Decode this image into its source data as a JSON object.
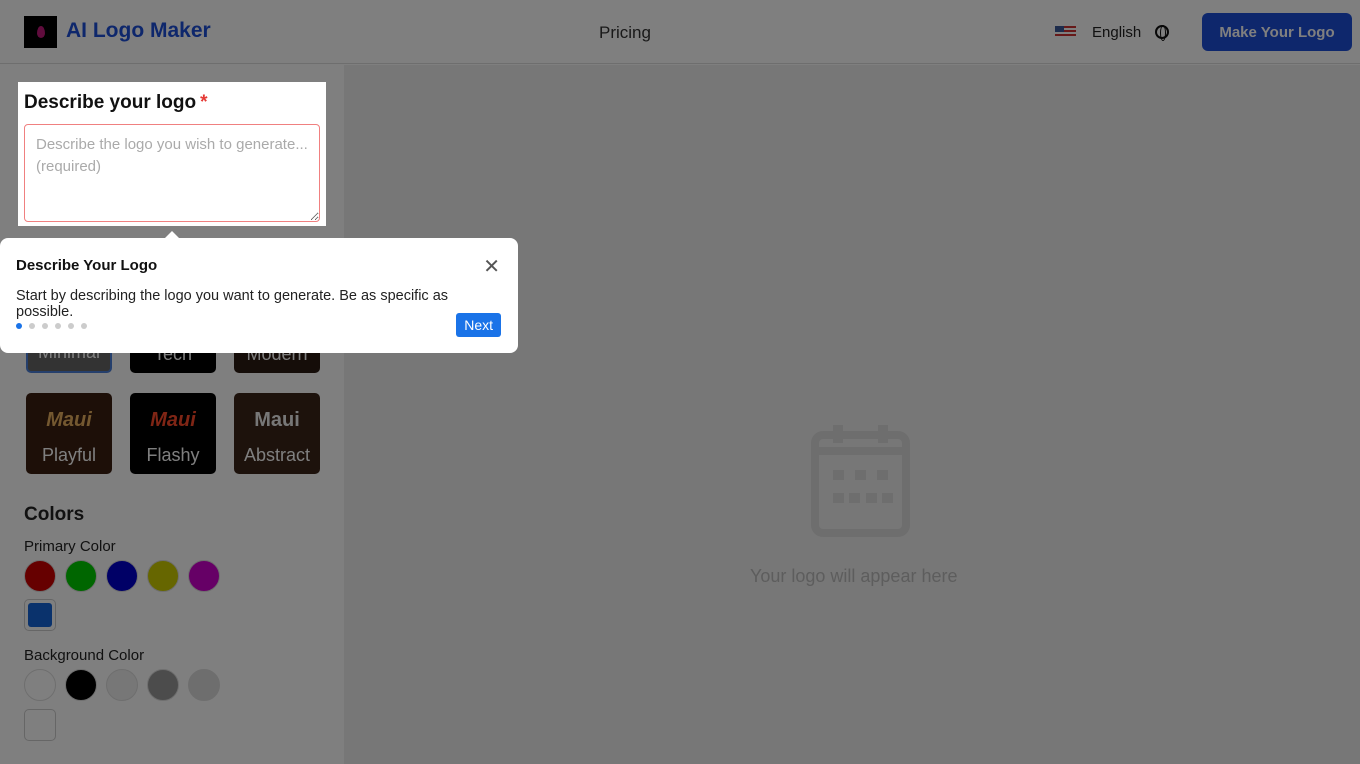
{
  "header": {
    "brand": "AI Logo Maker",
    "pricing": "Pricing",
    "language": "English",
    "cta": "Make Your Logo"
  },
  "describe": {
    "title": "Describe your logo",
    "required_mark": "*",
    "placeholder": "Describe the logo you wish to generate... (required)",
    "value": ""
  },
  "styles": [
    {
      "label": "Minimal",
      "selected": true
    },
    {
      "label": "Tech"
    },
    {
      "label": "Modern"
    },
    {
      "label": "Playful",
      "art": "Maui"
    },
    {
      "label": "Flashy",
      "art": "Maui"
    },
    {
      "label": "Abstract",
      "art": "Maui"
    }
  ],
  "colors": {
    "title": "Colors",
    "primary_label": "Primary Color",
    "primary": [
      "#cc0000",
      "#00cc00",
      "#0000cc",
      "#cccc00",
      "#cc00cc"
    ],
    "primary_custom": "#1565d8",
    "background_label": "Background Color",
    "background": [
      "#ffffff",
      "#000000",
      "#eeeeee",
      "#999999",
      "#dddddd"
    ],
    "background_custom": "#ffffff"
  },
  "main": {
    "placeholder": "Your logo will appear here"
  },
  "tour": {
    "title": "Describe Your Logo",
    "body": "Start by describing the logo you want to generate. Be as specific as possible.",
    "steps": 6,
    "current_step": 1,
    "next": "Next"
  }
}
